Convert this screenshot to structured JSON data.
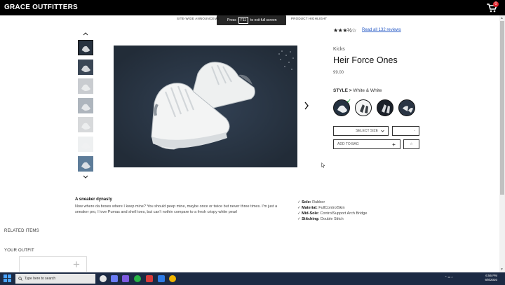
{
  "header": {
    "logo": "GRACE OUTFITTERS",
    "cart_icon": "cart-icon",
    "cart_count": "0"
  },
  "announcement": {
    "left": "SITE-WIDE ANNOUNCEME",
    "right": "PRODUCT HIGHLIGHT"
  },
  "fullscreen_toast": {
    "press": "Press",
    "key": "F11",
    "rest": "to exit full screen"
  },
  "gallery": {
    "up_icon": "chevron-up-icon",
    "down_icon": "chevron-down-icon",
    "next_icon": "chevron-right-icon",
    "thumbnail_count": 7
  },
  "product": {
    "rating": 3.5,
    "stars": "★★★½☆",
    "reviews_link": "Read all 132 reviews",
    "category": "Kicks",
    "name": "Heir Force Ones",
    "price": "99.00",
    "style_label": "STYLE >",
    "style_value": "White & White",
    "selected_check": "✓",
    "size_select": "SELECT SIZE",
    "qty_select": "-",
    "add_to_bag": "ADD TO BAG",
    "add_to_bag_icon": "plus-icon",
    "favorite": "☆"
  },
  "description": {
    "title": "A sneaker dynasty",
    "body": "Now where da boxes where I keep mine? You should peep mine, maybe once or twice but never three times. I'm just a sneaker pro, I love Pumas and shell toes, but can't nothin compare to a fresh crispy white pearl",
    "features": [
      {
        "label": "Sole:",
        "value": "Rubber"
      },
      {
        "label": "Material:",
        "value": "FullControlSkin"
      },
      {
        "label": "Mid-Sole:",
        "value": "ControlSupport Arch Bridge"
      },
      {
        "label": "Stitching:",
        "value": "Double Stitch"
      }
    ]
  },
  "sections": {
    "related": "RELATED ITEMS",
    "outfit": "YOUR OUTFIT",
    "add_outfit": "+"
  },
  "taskbar": {
    "search_placeholder": "Type here to search",
    "time": "6:56 PM",
    "date": "6/8/2020"
  }
}
